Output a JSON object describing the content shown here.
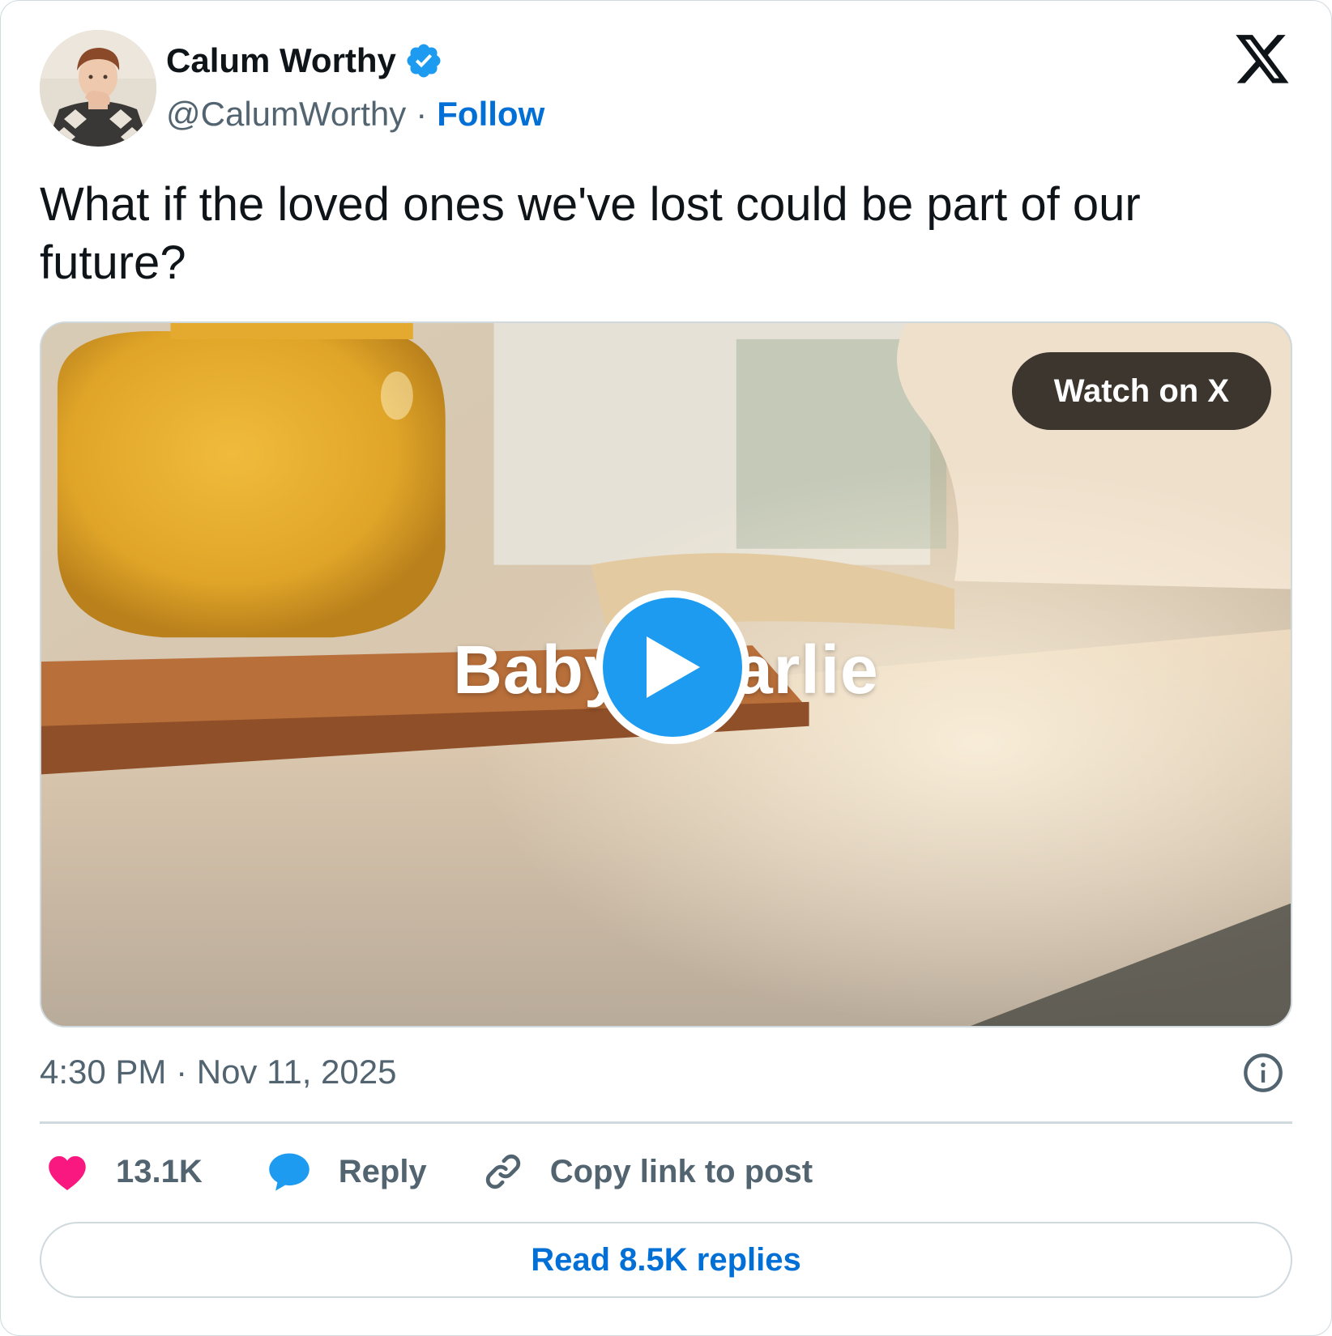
{
  "author": {
    "name": "Calum Worthy",
    "handle": "@CalumWorthy",
    "separator": "·",
    "follow_label": "Follow",
    "verified": true
  },
  "icons": {
    "verified": "verified-badge-icon",
    "logo": "x-logo-icon",
    "info": "info-icon",
    "like": "heart-icon",
    "reply": "speech-bubble-icon",
    "copy": "link-icon",
    "play": "play-icon"
  },
  "post": {
    "text": "What if the loved ones we've lost could be part of our future?"
  },
  "media": {
    "watch_label": "Watch on X",
    "overlay_title": "Baby Charlie"
  },
  "meta": {
    "timestamp": "4:30 PM · Nov 11, 2025"
  },
  "actions": {
    "like_count": "13.1K",
    "reply_label": "Reply",
    "copy_label": "Copy link to post"
  },
  "replies": {
    "label": "Read 8.5K replies"
  },
  "colors": {
    "accent": "#1d9bf0",
    "link": "#006fd6",
    "like": "#f91880",
    "muted": "#536471",
    "border": "#cfd9de"
  }
}
